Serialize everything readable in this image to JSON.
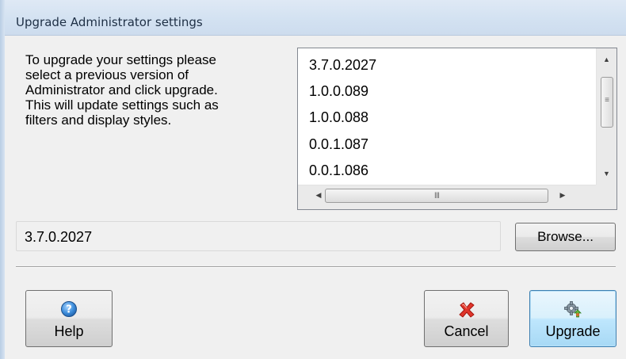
{
  "window": {
    "title": "Upgrade Administrator settings"
  },
  "description": "To upgrade your settings please\nselect a previous version of\nAdministrator and click upgrade.\nThis will update settings such as\nfilters and display styles.",
  "version_list": {
    "items": [
      "3.7.0.2027",
      "1.0.0.089",
      "1.0.0.088",
      "0.0.1.087",
      "0.0.1.086"
    ],
    "scrollbar_grip_h": "III",
    "scrollbar_grip_v": "≡"
  },
  "path_field": {
    "value": "3.7.0.2027"
  },
  "buttons": {
    "browse": "Browse...",
    "help": "Help",
    "cancel": "Cancel",
    "upgrade": "Upgrade"
  },
  "icons": {
    "help": "help-circle-icon",
    "cancel": "red-x-icon",
    "upgrade": "gear-upgrade-icon"
  },
  "colors": {
    "titlebar": "#d2e1f1",
    "client": "#f0f0f0",
    "upgrade_focus": "#3c7fb1"
  }
}
